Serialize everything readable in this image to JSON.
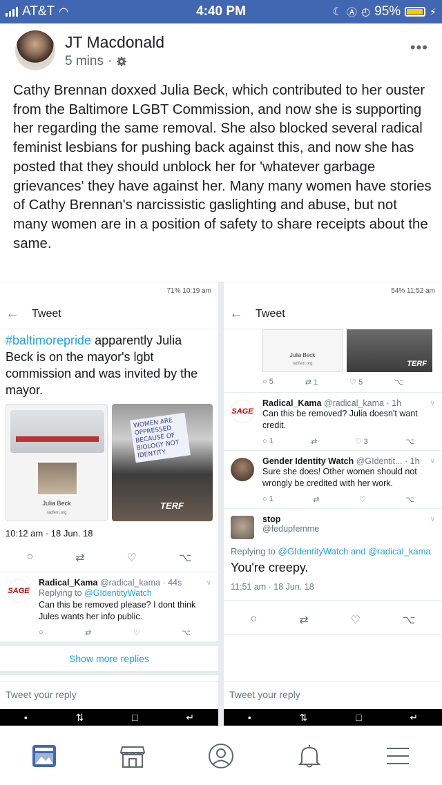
{
  "status_bar": {
    "carrier": "AT&T",
    "time": "4:40 PM",
    "battery": "95%",
    "battery_fraction": 0.95
  },
  "post": {
    "author": "JT Macdonald",
    "time": "5 mins",
    "separator": "·",
    "text": "Cathy Brennan doxxed Julia Beck, which contributed to her ouster from the Baltimore LGBT Commission, and now she is supporting her regarding the same removal. She also blocked several radical feminist lesbians for pushing back against this, and now she has posted that they should unblock her for 'whatever garbage grievances' they have against her. Many many women have stories of Cathy Brennan's narcissistic gaslighting and abuse, but not many women are in a position of safety to share receipts about the same."
  },
  "left_shot": {
    "status": "71%  10:19 am",
    "header_title": "Tweet",
    "hashtag": "#baltimorepride",
    "tweet_text": " apparently Julia Beck is on the mayor's lgbt commission and was invited by the mayor.",
    "card_caption": "Julia Beck",
    "card_site": "radfem.org",
    "sign_text": "WOMEN ARE OPPRESSED BECAUSE OF BIOLOGY NOT IDENTITY",
    "terf_label": "TERF",
    "timestamp": "10:12 am · 18 Jun. 18",
    "reply": {
      "name": "Radical_Kama",
      "handle": "@radical_kama · 44s",
      "replying_prefix": "Replying to ",
      "replying_to": "@GIdentityWatch",
      "body": "Can this be removed please? I dont think Jules wants her info public."
    },
    "show_more": "Show more replies",
    "reply_placeholder": "Tweet your reply"
  },
  "right_shot": {
    "status": "54%  11:52 am",
    "header_title": "Tweet",
    "card_caption": "Julia Beck",
    "card_site": "radfem.org",
    "stats": {
      "replies": "5",
      "retweets": "1",
      "likes": "5"
    },
    "replies": [
      {
        "name": "Radical_Kama",
        "handle": "@radical_kama · 1h",
        "body": "Can this be removed? Julia doesn't want credit.",
        "replies": "1",
        "likes": "3"
      },
      {
        "name": "Gender Identity Watch",
        "handle": "@GIdentit... · 1h",
        "body": "Sure she does! Other women should not wrongly be credited with her work.",
        "replies": "1"
      }
    ],
    "stop": {
      "name": "stop",
      "handle": "@fedupfemme",
      "replying_prefix": "Replying to ",
      "replying_to": "@GIdentityWatch and @radical_kama",
      "body": "You're creepy.",
      "timestamp": "11:51 am · 18 Jun. 18"
    },
    "reply_placeholder": "Tweet your reply"
  },
  "fb_nav": [
    "news-feed-icon",
    "marketplace-icon",
    "profile-icon",
    "notifications-icon",
    "menu-icon"
  ],
  "colors": {
    "fb_blue": "#4267b2",
    "twitter_blue": "#1da1f2",
    "text": "#1c1e21"
  }
}
